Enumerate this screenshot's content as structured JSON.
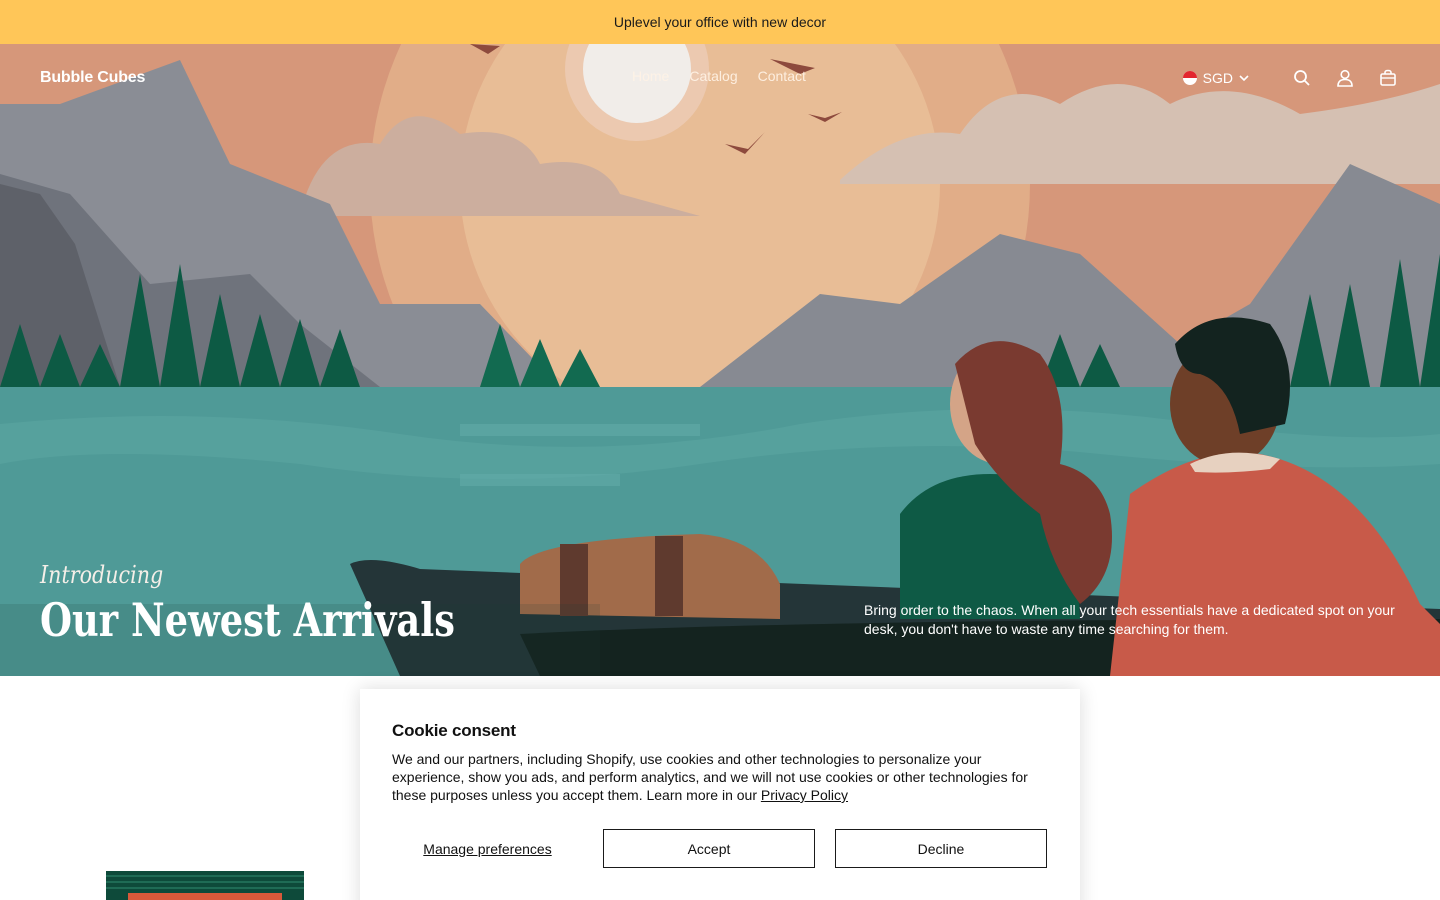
{
  "announcement": {
    "text": "Uplevel your office with new decor"
  },
  "header": {
    "brand": "Bubble Cubes",
    "nav": [
      {
        "label": "Home"
      },
      {
        "label": "Catalog"
      },
      {
        "label": "Contact"
      }
    ],
    "currency": "SGD",
    "icons": [
      "search-icon",
      "account-icon",
      "cart-icon"
    ]
  },
  "hero": {
    "kicker": "Introducing",
    "title": "Our Newest Arrivals",
    "description": "Bring order to the chaos. When all your tech essentials have a dedicated spot on your desk, you don't have to waste any time searching for them."
  },
  "cookie": {
    "title": "Cookie consent",
    "body": "We and our partners, including Shopify, use cookies and other technologies to personalize your experience, show you ads, and perform analytics, and we will not use cookies or other technologies for these purposes unless you accept them. Learn more in our ",
    "link": "Privacy Policy",
    "manage": "Manage preferences",
    "accept": "Accept",
    "decline": "Decline"
  },
  "colors": {
    "announcement_bg": "#ffc658",
    "sky": "#d99b7b",
    "lake": "#4f9a97",
    "forest": "#0c5a45"
  }
}
